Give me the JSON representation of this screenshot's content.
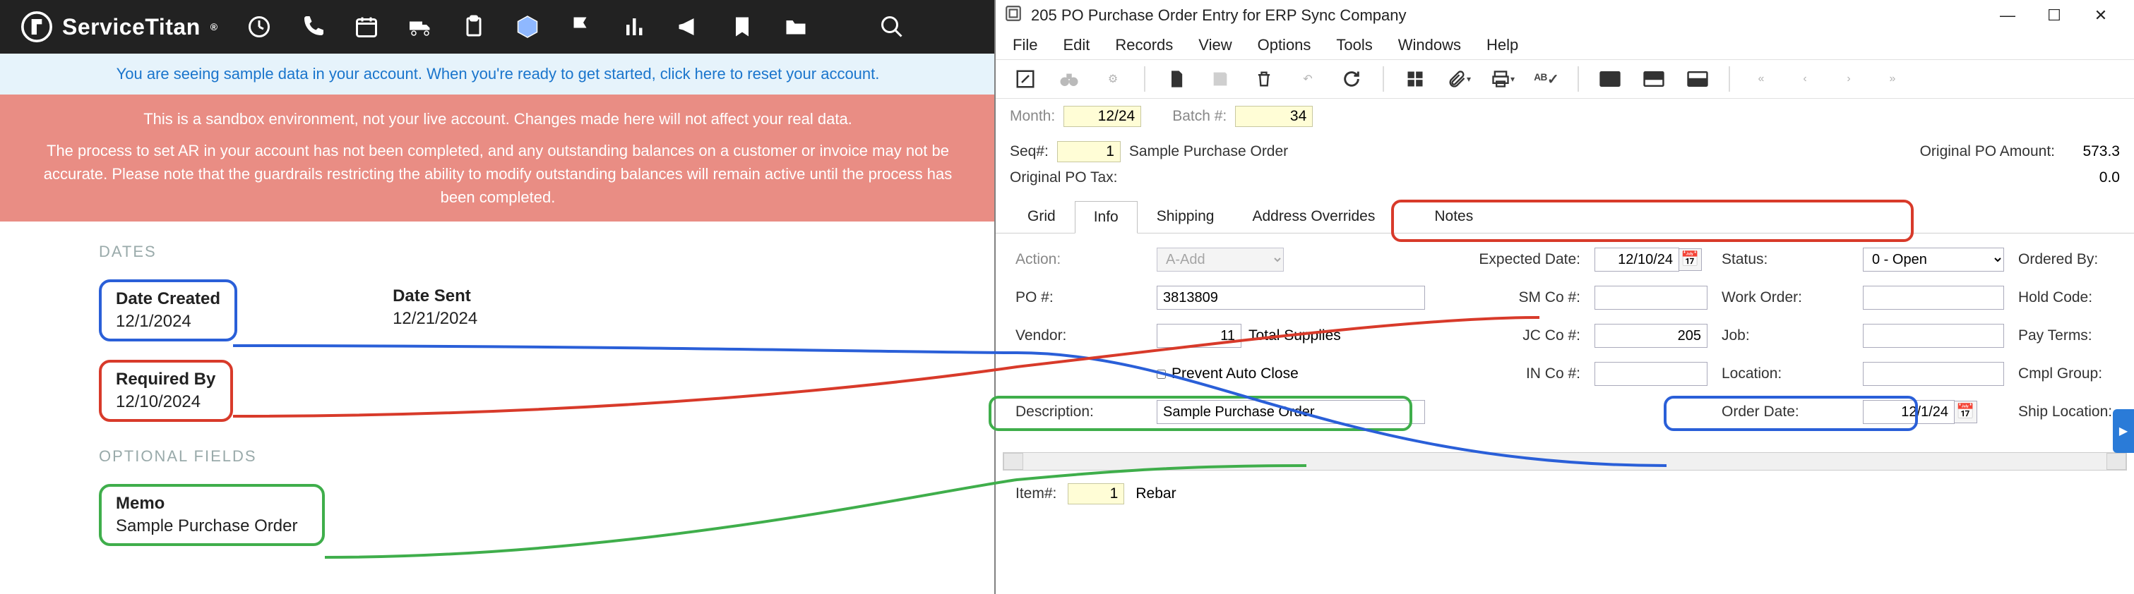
{
  "left": {
    "brand": "ServiceTitan",
    "banner_blue": "You are seeing sample data in your account. When you're ready to get started, click here to reset your account.",
    "banner_pink_line1": "This is a sandbox environment, not your live account. Changes made here will not affect your real data.",
    "banner_pink_line2": "The process to set AR in your account has not been completed, and any outstanding balances on a customer or invoice may not be accurate. Please note that the guardrails restricting the ability to modify outstanding balances will remain active until the process has been completed.",
    "sections": {
      "dates_title": "DATES",
      "optional_title": "OPTIONAL FIELDS"
    },
    "date_created_label": "Date Created",
    "date_created_value": "12/1/2024",
    "date_sent_label": "Date Sent",
    "date_sent_value": "12/21/2024",
    "required_by_label": "Required By",
    "required_by_value": "12/10/2024",
    "memo_label": "Memo",
    "memo_value": "Sample Purchase Order"
  },
  "right": {
    "window_title": "205 PO Purchase Order Entry for ERP Sync Company",
    "menus": {
      "file": "File",
      "edit": "Edit",
      "records": "Records",
      "view": "View",
      "options": "Options",
      "tools": "Tools",
      "windows": "Windows",
      "help": "Help"
    },
    "header": {
      "month_label": "Month:",
      "month_value": "12/24",
      "batch_label": "Batch #:",
      "batch_value": "34",
      "seq_label": "Seq#:",
      "seq_value": "1",
      "seq_text": "Sample Purchase Order",
      "orig_amt_label": "Original PO Amount:",
      "orig_amt_value": "573.3",
      "orig_tax_label": "Original PO Tax:",
      "orig_tax_value": "0.0"
    },
    "tabs": {
      "grid": "Grid",
      "info": "Info",
      "shipping": "Shipping",
      "addr": "Address Overrides",
      "notes": "Notes"
    },
    "form": {
      "action_label": "Action:",
      "action_value": "A-Add",
      "expected_label": "Expected Date:",
      "expected_value": "12/10/24",
      "status_label": "Status:",
      "status_value": "0 - Open",
      "ordered_by_label": "Ordered By:",
      "ordered_by_value": "",
      "po_label": "PO #:",
      "po_value": "3813809",
      "smco_label": "SM Co #:",
      "smco_value": "",
      "wo_label": "Work Order:",
      "wo_value": "",
      "hold_label": "Hold Code:",
      "hold_value": "",
      "vendor_label": "Vendor:",
      "vendor_value": "11",
      "vendor_name": "Total Supplies",
      "jcco_label": "JC Co #:",
      "jcco_value": "205",
      "job_label": "Job:",
      "job_value": "",
      "payterms_label": "Pay Terms:",
      "payterms_value": "",
      "prevent_auto": "Prevent Auto Close",
      "inco_label": "IN Co #:",
      "inco_value": "",
      "location_label": "Location:",
      "location_value": "",
      "cmpl_label": "Cmpl Group:",
      "cmpl_value": "",
      "desc_label": "Description:",
      "desc_value": "Sample Purchase Order",
      "orderdate_label": "Order Date:",
      "orderdate_value": "12/1/24",
      "shiploc_label": "Ship Location:",
      "shiploc_value": ""
    },
    "item_row": {
      "item_label": "Item#:",
      "item_value": "1",
      "item_name": "Rebar"
    }
  }
}
